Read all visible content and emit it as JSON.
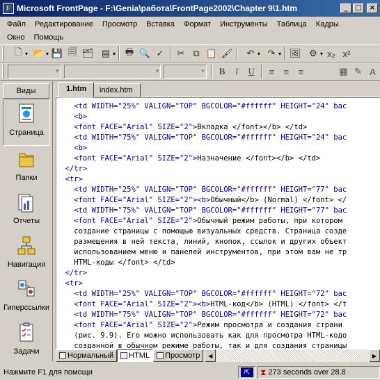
{
  "window": {
    "title": "Microsoft FrontPage - F:\\Genia\\работа\\FrontPage2002\\Chapter 9\\1.htm",
    "minimize": "_",
    "maximize": "□",
    "close": "×"
  },
  "menubar": {
    "items": [
      "Файл",
      "Редактирование",
      "Просмотр",
      "Вставка",
      "Формат",
      "Инструменты",
      "Таблица",
      "Кадры",
      "Окно",
      "Помощь"
    ]
  },
  "views": {
    "header": "Виды",
    "items": [
      {
        "label": "Страница",
        "icon": "page-view-icon"
      },
      {
        "label": "Папки",
        "icon": "folders-view-icon"
      },
      {
        "label": "Отчеты",
        "icon": "reports-view-icon"
      },
      {
        "label": "Навигация",
        "icon": "navigation-view-icon"
      },
      {
        "label": "Гиперссылки",
        "icon": "hyperlinks-view-icon"
      },
      {
        "label": "Задачи",
        "icon": "tasks-view-icon"
      }
    ]
  },
  "tabs": [
    {
      "label": "1.htm",
      "active": true
    },
    {
      "label": "index.htm",
      "active": false
    }
  ],
  "code": [
    {
      "tag": "    <td WIDTH=\"25%\" VALIGN=\"TOP\" BGCOLOR=\"#ffffff\" HEIGHT=\"24\" bac",
      "text": ""
    },
    {
      "tag": "    <b>",
      "text": ""
    },
    {
      "tag": "    <font FACE=\"Arial\" SIZE=\"2\">",
      "text": "Вкладка </font></b> </td>"
    },
    {
      "tag": "    <td WIDTH=\"75%\" VALIGN=\"TOP\" BGCOLOR=\"#ffffff\" HEIGHT=\"24\" bac",
      "text": ""
    },
    {
      "tag": "    <b>",
      "text": ""
    },
    {
      "tag": "    <font FACE=\"Arial\" SIZE=\"2\">",
      "text": "Назначение </font></b> </td>"
    },
    {
      "tag": "  </tr>",
      "text": ""
    },
    {
      "tag": "  <tr>",
      "text": ""
    },
    {
      "tag": "    <td WIDTH=\"25%\" VALIGN=\"TOP\" BGCOLOR=\"#ffffff\" HEIGHT=\"77\" bac",
      "text": ""
    },
    {
      "tag": "    <font FACE=\"Arial\" SIZE=\"2\"><b>",
      "text": "Обычный</b> (Normal) </font> </"
    },
    {
      "tag": "    <td WIDTH=\"75%\" VALIGN=\"TOP\" BGCOLOR=\"#ffffff\" HEIGHT=\"77\" bac",
      "text": ""
    },
    {
      "tag": "    <font FACE=\"Arial\" SIZE=\"2\">",
      "text": "Обычный режим работы, при котором"
    },
    {
      "tag": "",
      "text": "    создание страницы с помощью визуальных средств. Страница созде"
    },
    {
      "tag": "",
      "text": "    размещения в ней текста, линий, кнопок, ссылок и других объект"
    },
    {
      "tag": "",
      "text": "    использованием меню и панелей инструментов, при этом вам не тр"
    },
    {
      "tag": "",
      "text": "    HTML-коды </font> </td>"
    },
    {
      "tag": "  </tr>",
      "text": ""
    },
    {
      "tag": "  <tr>",
      "text": ""
    },
    {
      "tag": "    <td WIDTH=\"25%\" VALIGN=\"TOP\" BGCOLOR=\"#ffffff\" HEIGHT=\"72\" bac",
      "text": ""
    },
    {
      "tag": "    <font FACE=\"Arial\" SIZE=\"2\"><b>",
      "text": "HTML-код</b> (HTML) </font> </t"
    },
    {
      "tag": "    <td WIDTH=\"75%\" VALIGN=\"TOP\" BGCOLOR=\"#ffffff\" HEIGHT=\"72\" bac",
      "text": ""
    },
    {
      "tag": "    <font FACE=\"Arial\" SIZE=\"2\">",
      "text": "Режим просмотра и создания страни"
    },
    {
      "tag": "",
      "text": "    (рис. 9.9). Его можно использовать как для просмотра HTML-кодо"
    },
    {
      "tag": "",
      "text": "    созданной в обычном режиме работы, так и для создания страницы"
    }
  ],
  "bottom_tabs": [
    {
      "label": "Нормальный",
      "active": false
    },
    {
      "label": "HTML",
      "active": true
    },
    {
      "label": "Просмотр",
      "active": false
    }
  ],
  "status": {
    "help": "Нажмите F1 для помощи",
    "download": "273 seconds over 28.8"
  }
}
